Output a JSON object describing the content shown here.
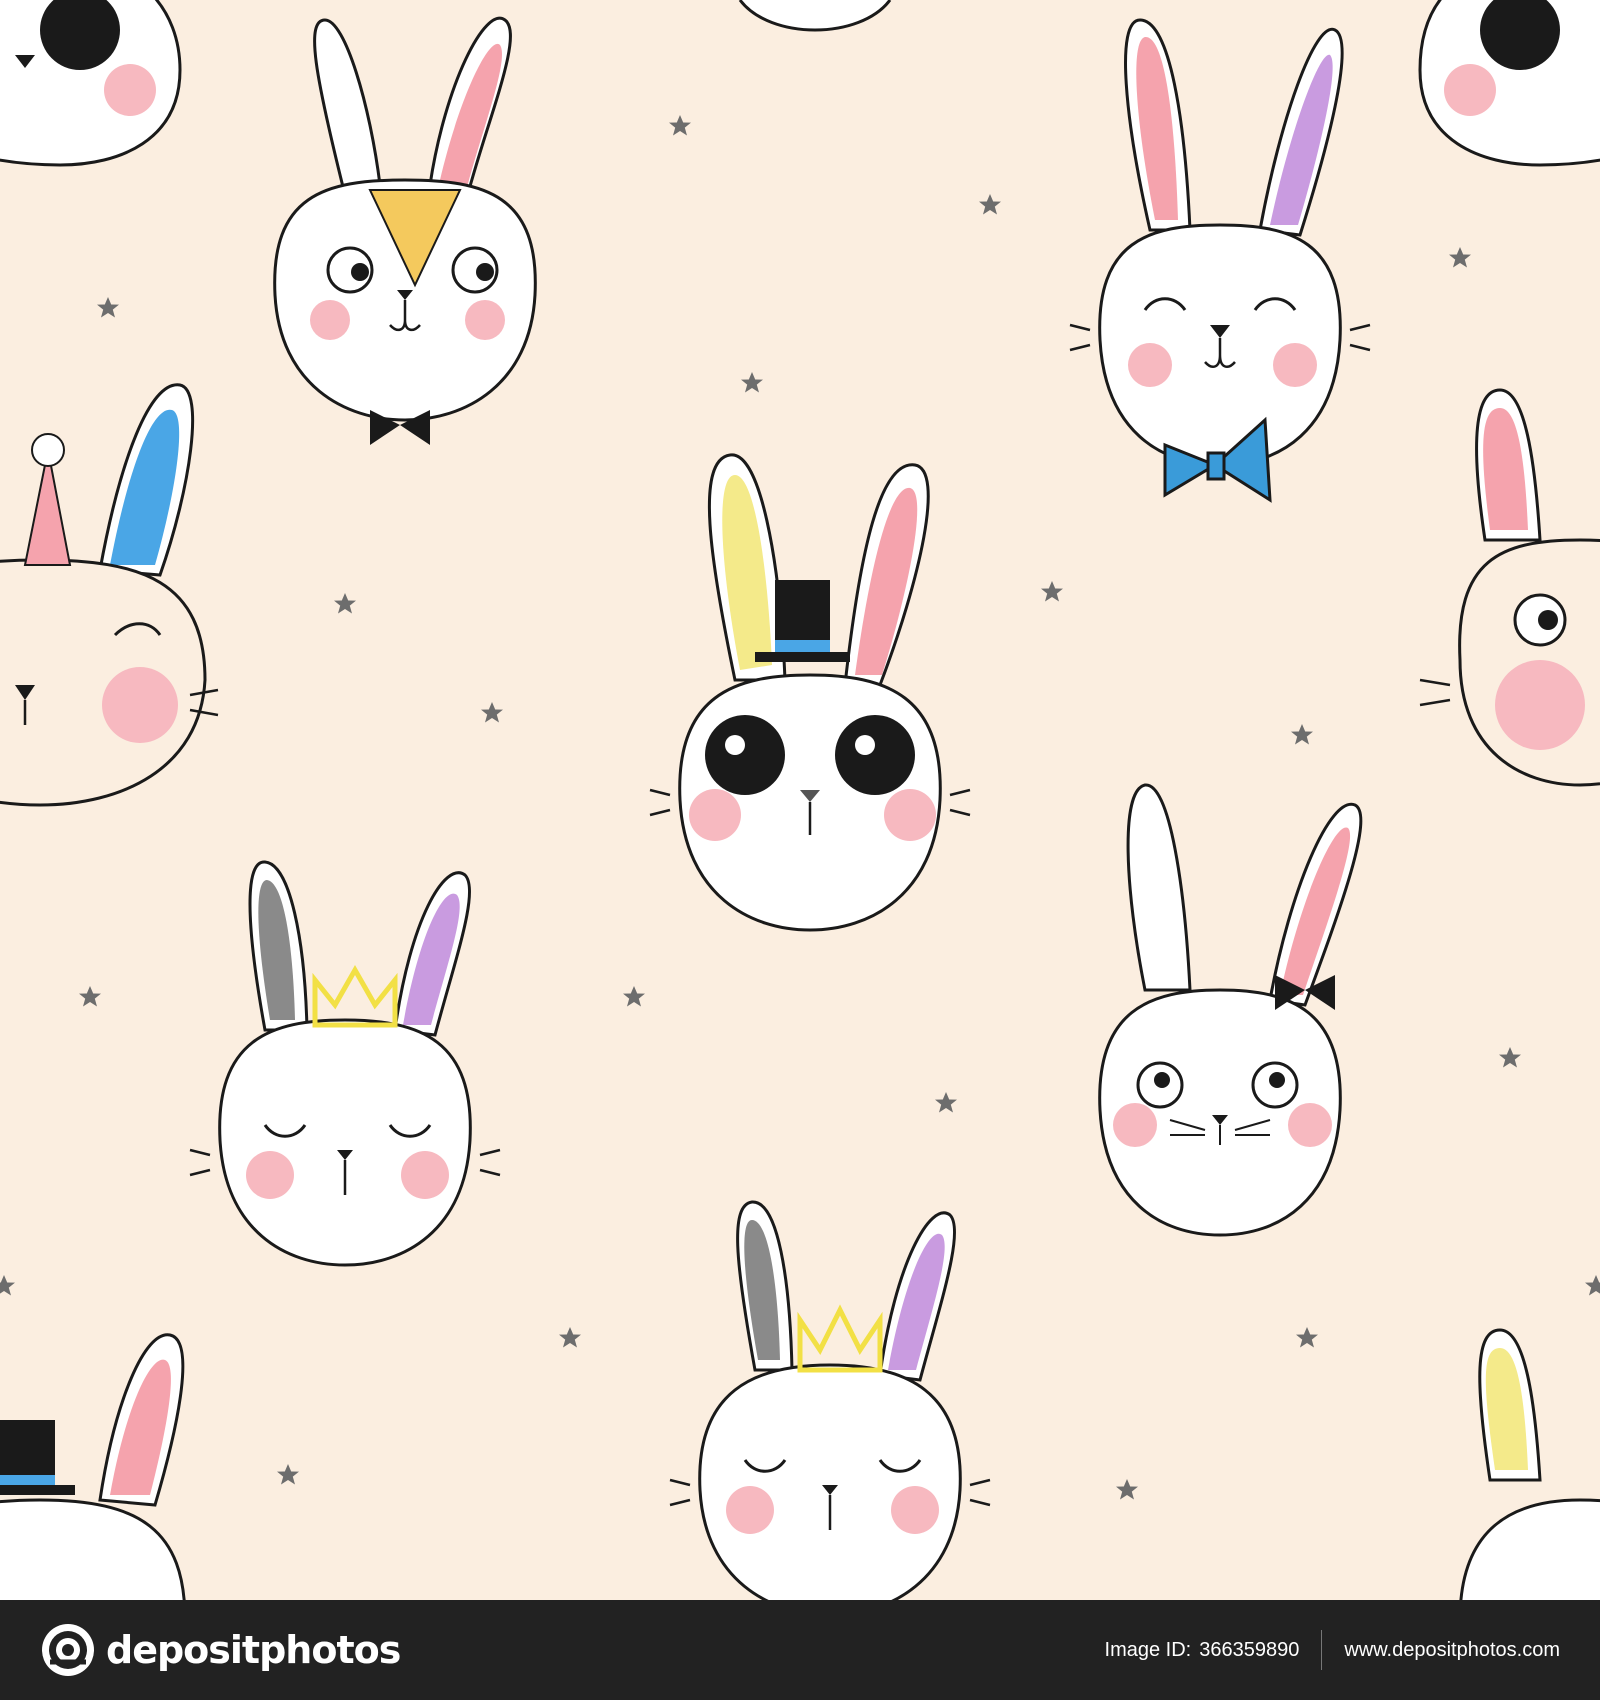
{
  "pattern": {
    "background_color": "#fbeee0",
    "star_color": "#6d6d6d",
    "outline_color": "#1a1a1a",
    "cheek_color": "#f7b9c0",
    "ear_pink": "#f5a3ad",
    "ear_yellow": "#f4ea8a",
    "ear_purple": "#c99be0",
    "ear_gray": "#8a8a8a",
    "ear_blue": "#4aa6e6",
    "bowtie_blue": "#3a9bd9",
    "crown_yellow": "#f2e045"
  },
  "watermark": {
    "text": "depositphotos"
  },
  "footer": {
    "brand": "depositphotos",
    "image_id_label": "Image ID:",
    "image_id": "366359890",
    "website": "www.depositphotos.com",
    "background_color": "#222222"
  }
}
